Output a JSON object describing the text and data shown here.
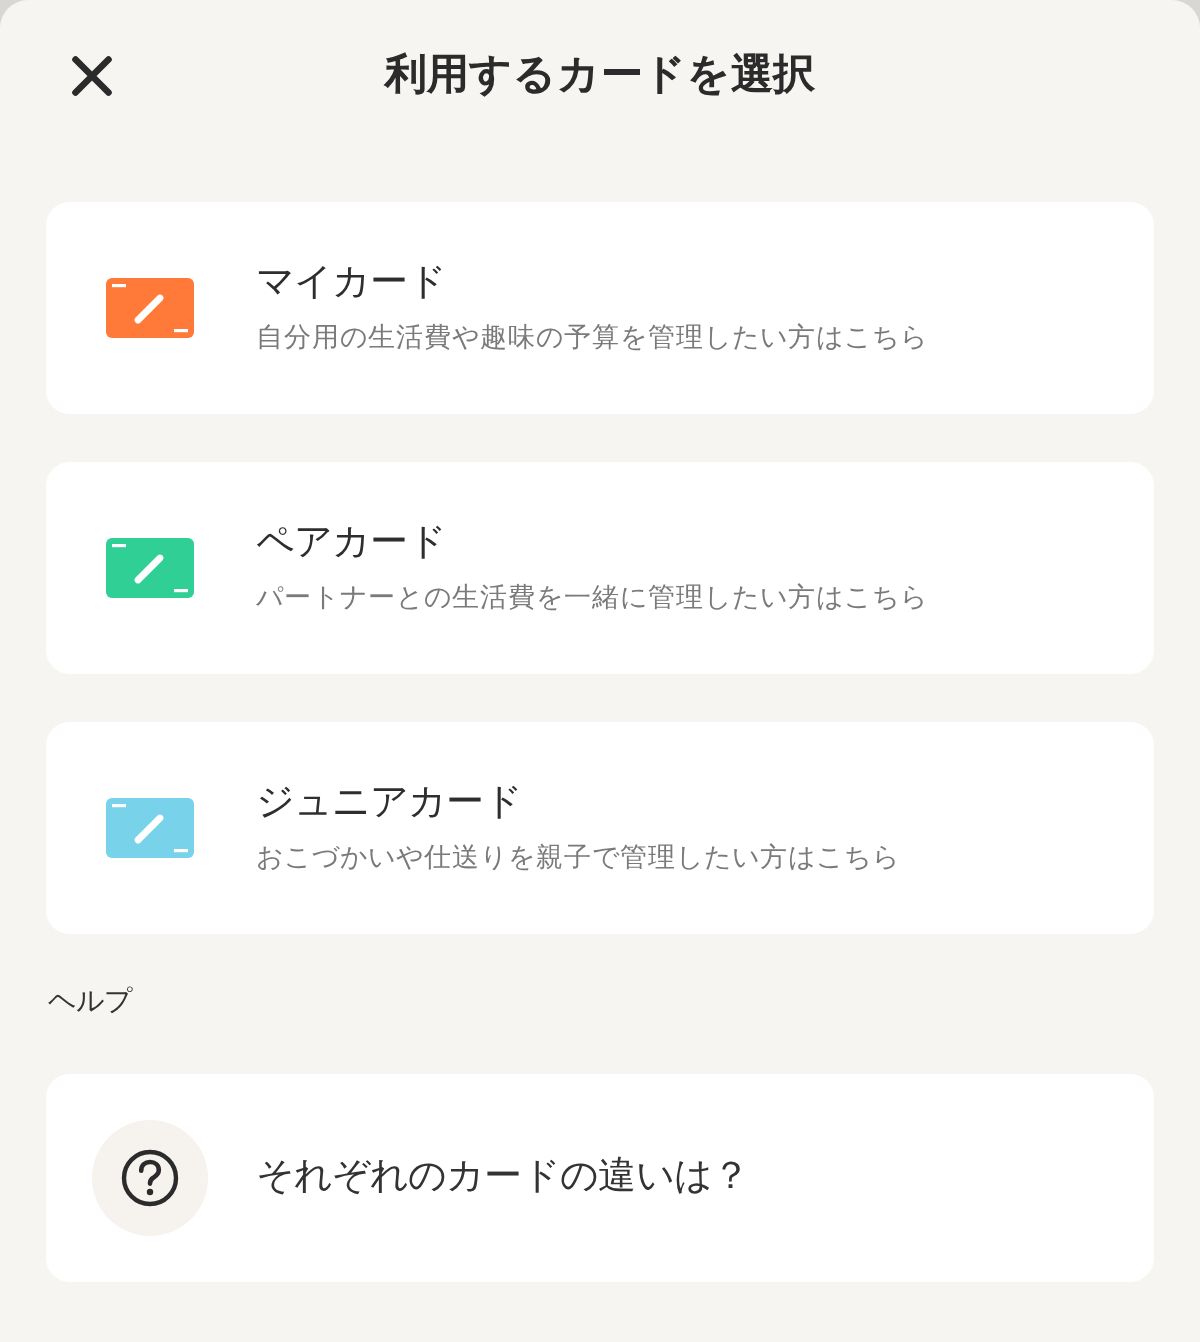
{
  "header": {
    "title": "利用するカードを選択"
  },
  "card_options": [
    {
      "title": "マイカード",
      "description": "自分用の生活費や趣味の予算を管理したい方はこちら",
      "color": "#ff7a38"
    },
    {
      "title": "ペアカード",
      "description": "パートナーとの生活費を一緒に管理したい方はこちら",
      "color": "#2fcf95"
    },
    {
      "title": "ジュニアカード",
      "description": "おこづかいや仕送りを親子で管理したい方はこちら",
      "color": "#78d2ea"
    }
  ],
  "help": {
    "heading": "ヘルプ",
    "items": [
      {
        "label": "それぞれのカードの違いは？"
      }
    ]
  }
}
